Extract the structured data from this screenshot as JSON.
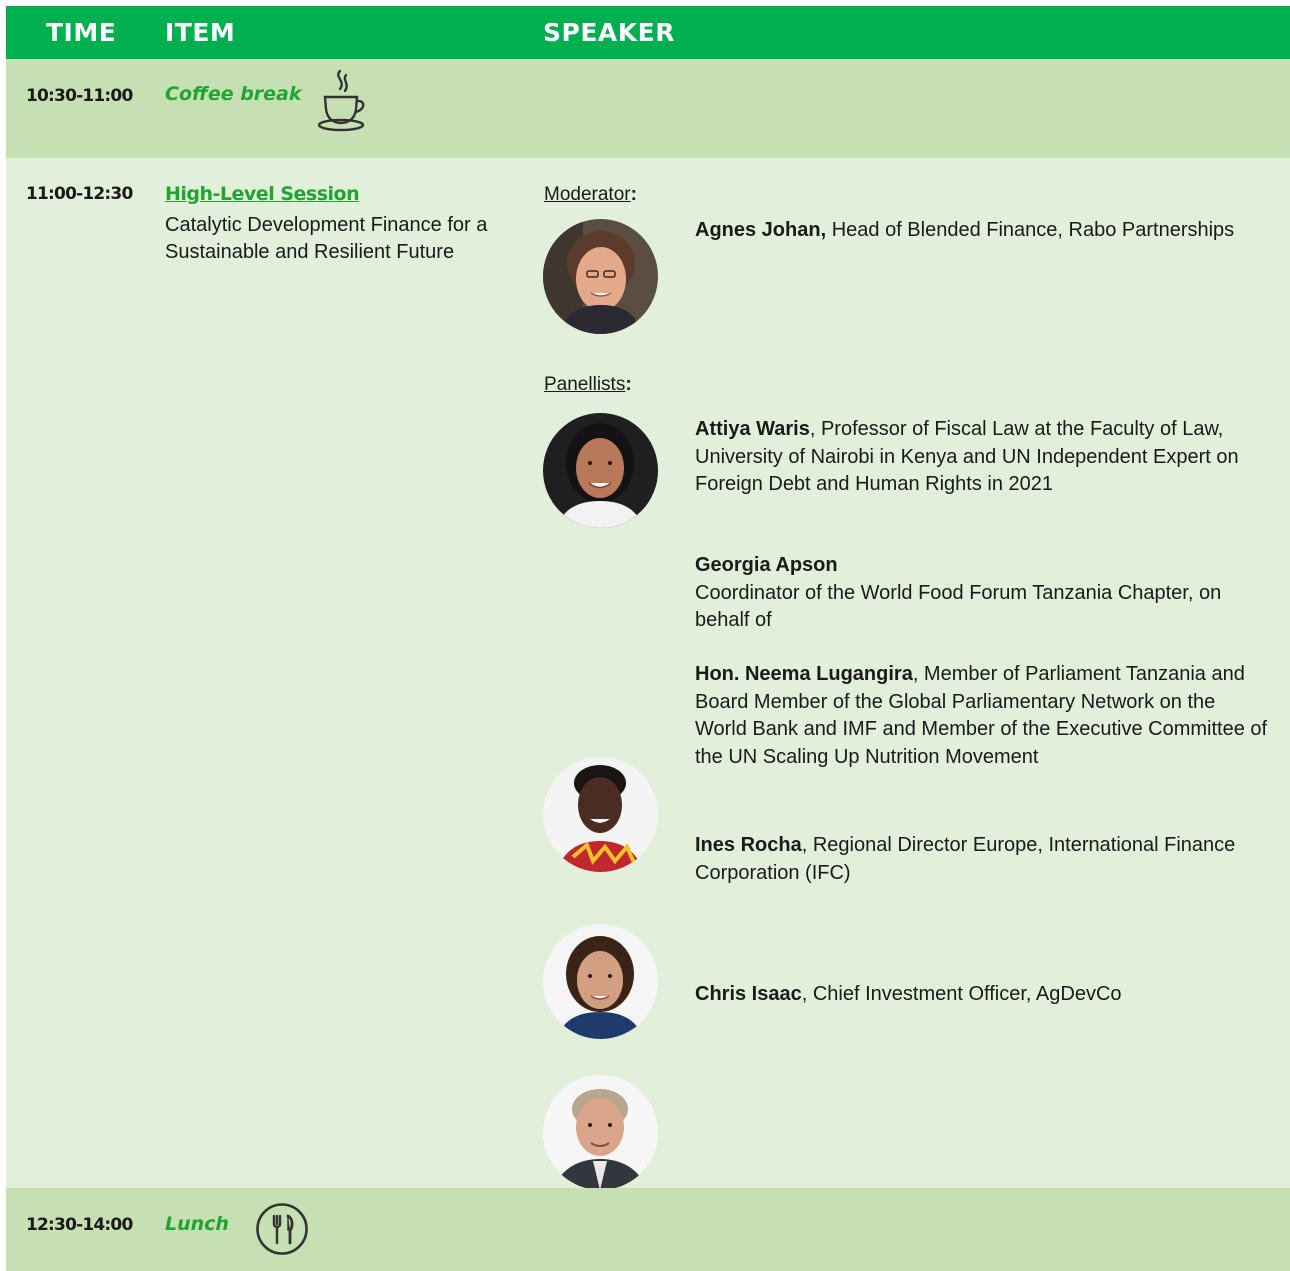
{
  "header": {
    "time": "TIME",
    "item": "ITEM",
    "speaker": "SPEAKER"
  },
  "coffee": {
    "time": "10:30-11:00",
    "label": "Coffee break",
    "icon": "coffee-cup-icon"
  },
  "session": {
    "time": "11:00-12:30",
    "title": "High-Level Session",
    "subtitle": "Catalytic Development Finance for a Sustainable and Resilient Future",
    "moderator_label": "Moderator",
    "panellists_label": "Panellists",
    "colon": ":",
    "moderator": {
      "name": "Agnes Johan,",
      "desc": " Head of Blended Finance, Rabo Partnerships"
    },
    "panellists": [
      {
        "name": "Attiya Waris",
        "desc": ", Professor of Fiscal Law at the Faculty of Law, University of Nairobi in Kenya and UN Independent Expert on Foreign Debt and Human Rights in 2021"
      },
      {
        "name": "Georgia Apson",
        "desc": "Coordinator of the World Food Forum Tanzania Chapter, on behalf of"
      },
      {
        "name": "Hon. Neema Lugangira",
        "desc": ", Member of Parliament Tanzania and Board Member of the Global Parliamentary Network on the World Bank and IMF and Member of the Executive Committee of the UN Scaling Up Nutrition Movement"
      },
      {
        "name": "Ines Rocha",
        "desc": ", Regional Director Europe, International Finance Corporation (IFC)"
      },
      {
        "name": "Chris Isaac",
        "desc": ", Chief Investment Officer, AgDevCo"
      }
    ]
  },
  "lunch": {
    "time": "12:30-14:00",
    "label": "Lunch",
    "icon": "fork-knife-icon"
  },
  "colors": {
    "header": "#00b050",
    "highlight_row": "#c6e0b4",
    "light_row": "#e2efda",
    "accent_text": "#22a433"
  }
}
